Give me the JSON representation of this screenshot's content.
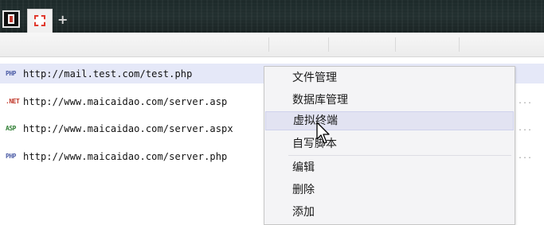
{
  "tabs": [
    {
      "name": "tab-1",
      "icon": "window-icon"
    },
    {
      "name": "tab-2",
      "icon": "dashed-square-icon"
    }
  ],
  "add_tab_label": "+",
  "rows": [
    {
      "badge": "PHP",
      "badge_color": "#5060a8",
      "url": "http://mail.test.com/test.php",
      "trail": ""
    },
    {
      "badge": ".NET",
      "badge_color": "#c0392b",
      "url": "http://www.maicaidao.com/server.asp",
      "trail": "..."
    },
    {
      "badge": "ASP",
      "badge_color": "#2e7d32",
      "url": "http://www.maicaidao.com/server.aspx",
      "trail": "..."
    },
    {
      "badge": "PHP",
      "badge_color": "#5060a8",
      "url": "http://www.maicaidao.com/server.php",
      "trail": "..."
    }
  ],
  "context_menu": {
    "items": [
      {
        "label": "文件管理"
      },
      {
        "label": "数据库管理"
      },
      {
        "label": "虚拟终端"
      },
      {
        "label": "自写脚本"
      },
      {
        "label": "编辑"
      },
      {
        "label": "删除"
      },
      {
        "label": "添加"
      }
    ],
    "hovered_index": 2
  },
  "colors": {
    "selected_row": "#e5e8f8",
    "menu_hover": "#e2e3f2"
  }
}
